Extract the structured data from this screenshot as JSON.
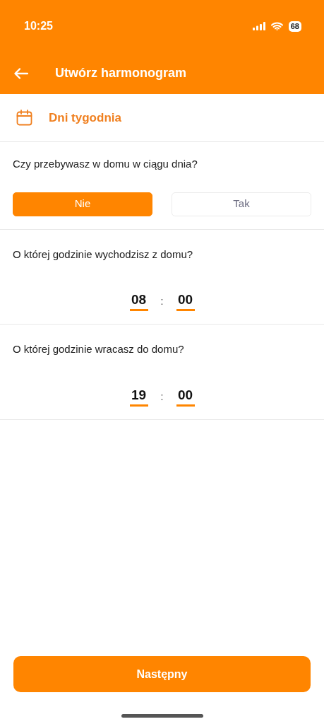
{
  "status_bar": {
    "time": "10:25",
    "battery": "68"
  },
  "header": {
    "title": "Utwórz harmonogram"
  },
  "section": {
    "title": "Dni tygodnia"
  },
  "question": {
    "label": "Czy przebywasz w domu w ciągu dnia?",
    "options": [
      {
        "label": "Nie",
        "selected": true
      },
      {
        "label": "Tak",
        "selected": false
      }
    ]
  },
  "times": [
    {
      "label": "O której godzinie wychodzisz z domu?",
      "hours": "08",
      "separator": ":",
      "minutes": "00"
    },
    {
      "label": "O której godzinie wracasz do domu?",
      "hours": "19",
      "separator": ":",
      "minutes": "00"
    }
  ],
  "next_button": "Następny"
}
